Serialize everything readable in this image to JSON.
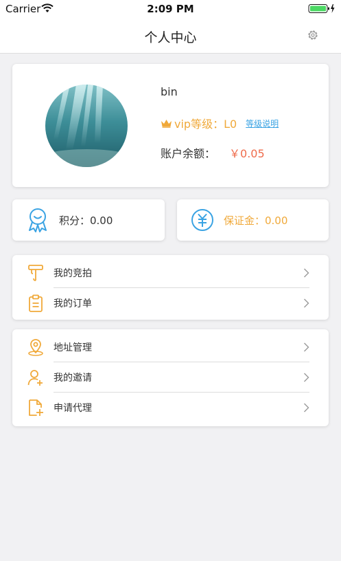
{
  "status_bar": {
    "carrier": "Carrier",
    "time": "2:09 PM"
  },
  "nav": {
    "title": "个人中心",
    "settings_icon": "gear-icon"
  },
  "profile": {
    "username": "bin",
    "vip_label": "vip等级：L0",
    "vip_link": "等级说明",
    "balance_label": "账户余额：",
    "balance_value": "￥0.05"
  },
  "stats": {
    "points": "积分：0.00",
    "deposit": "保证金：0.00"
  },
  "menu_groups": [
    {
      "items": [
        {
          "label": "我的竞拍",
          "icon": "auction-hammer-icon"
        },
        {
          "label": "我的订单",
          "icon": "clipboard-icon"
        }
      ]
    },
    {
      "items": [
        {
          "label": "地址管理",
          "icon": "location-pin-icon"
        },
        {
          "label": "我的邀请",
          "icon": "add-user-icon"
        },
        {
          "label": "申请代理",
          "icon": "add-document-icon"
        }
      ]
    }
  ],
  "colors": {
    "accent_orange": "#f0a93a",
    "accent_blue": "#3aa3e3",
    "price_red": "#ef6c4c",
    "background": "#f1f1f3"
  }
}
